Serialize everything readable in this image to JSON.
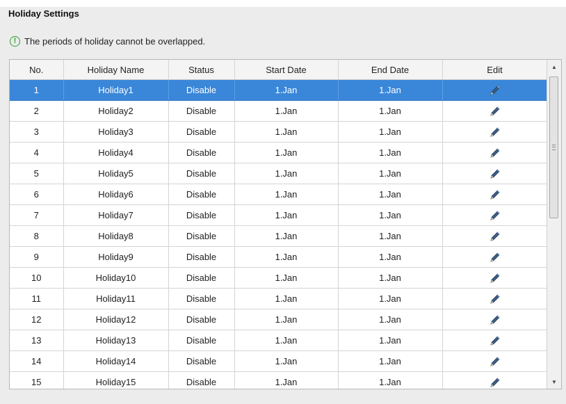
{
  "page": {
    "title": "Holiday Settings",
    "notice": "The periods of holiday cannot be overlapped.",
    "notice_icon": "info-exclamation-icon"
  },
  "table": {
    "columns": [
      "No.",
      "Holiday Name",
      "Status",
      "Start Date",
      "End Date",
      "Edit"
    ],
    "selected_row": 1,
    "rows": [
      {
        "no": "1",
        "name": "Holiday1",
        "status": "Disable",
        "start": "1.Jan",
        "end": "1.Jan"
      },
      {
        "no": "2",
        "name": "Holiday2",
        "status": "Disable",
        "start": "1.Jan",
        "end": "1.Jan"
      },
      {
        "no": "3",
        "name": "Holiday3",
        "status": "Disable",
        "start": "1.Jan",
        "end": "1.Jan"
      },
      {
        "no": "4",
        "name": "Holiday4",
        "status": "Disable",
        "start": "1.Jan",
        "end": "1.Jan"
      },
      {
        "no": "5",
        "name": "Holiday5",
        "status": "Disable",
        "start": "1.Jan",
        "end": "1.Jan"
      },
      {
        "no": "6",
        "name": "Holiday6",
        "status": "Disable",
        "start": "1.Jan",
        "end": "1.Jan"
      },
      {
        "no": "7",
        "name": "Holiday7",
        "status": "Disable",
        "start": "1.Jan",
        "end": "1.Jan"
      },
      {
        "no": "8",
        "name": "Holiday8",
        "status": "Disable",
        "start": "1.Jan",
        "end": "1.Jan"
      },
      {
        "no": "9",
        "name": "Holiday9",
        "status": "Disable",
        "start": "1.Jan",
        "end": "1.Jan"
      },
      {
        "no": "10",
        "name": "Holiday10",
        "status": "Disable",
        "start": "1.Jan",
        "end": "1.Jan"
      },
      {
        "no": "11",
        "name": "Holiday11",
        "status": "Disable",
        "start": "1.Jan",
        "end": "1.Jan"
      },
      {
        "no": "12",
        "name": "Holiday12",
        "status": "Disable",
        "start": "1.Jan",
        "end": "1.Jan"
      },
      {
        "no": "13",
        "name": "Holiday13",
        "status": "Disable",
        "start": "1.Jan",
        "end": "1.Jan"
      },
      {
        "no": "14",
        "name": "Holiday14",
        "status": "Disable",
        "start": "1.Jan",
        "end": "1.Jan"
      },
      {
        "no": "15",
        "name": "Holiday15",
        "status": "Disable",
        "start": "1.Jan",
        "end": "1.Jan"
      }
    ]
  },
  "colors": {
    "selected_row": "#3a87d9",
    "notice_icon": "#2e9e2e"
  }
}
